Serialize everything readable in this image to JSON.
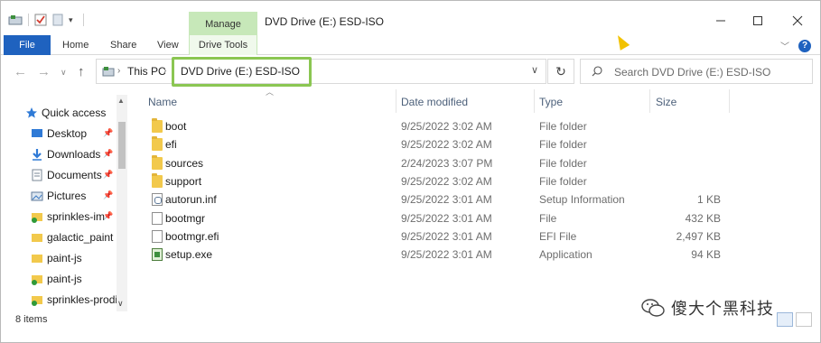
{
  "window": {
    "title": "DVD Drive (E:) ESD-ISO",
    "contextual_tab": "Manage"
  },
  "ribbon": {
    "tabs": [
      {
        "label": "File"
      },
      {
        "label": "Home"
      },
      {
        "label": "Share"
      },
      {
        "label": "View"
      },
      {
        "label": "Drive Tools"
      }
    ]
  },
  "address": {
    "breadcrumb": [
      "This PC",
      "DVD Drive (E:) ESD-ISO"
    ],
    "highlight_color": "#8bc652"
  },
  "search": {
    "placeholder": "Search DVD Drive (E:) ESD-ISO"
  },
  "nav": {
    "items": [
      {
        "label": "Quick access",
        "icon": "star-icon",
        "pinned": false
      },
      {
        "label": "Desktop",
        "icon": "desktop-icon",
        "pinned": true
      },
      {
        "label": "Downloads",
        "icon": "download-icon",
        "pinned": true
      },
      {
        "label": "Documents",
        "icon": "documents-icon",
        "pinned": true
      },
      {
        "label": "Pictures",
        "icon": "pictures-icon",
        "pinned": true
      },
      {
        "label": "sprinkles-im",
        "icon": "synced-folder-icon",
        "pinned": true
      },
      {
        "label": "galactic_paint",
        "icon": "folder-icon",
        "pinned": false
      },
      {
        "label": "paint-js",
        "icon": "folder-icon",
        "pinned": false
      },
      {
        "label": "paint-js",
        "icon": "synced-folder-icon",
        "pinned": false
      },
      {
        "label": "sprinkles-prodi",
        "icon": "synced-folder-icon",
        "pinned": false
      }
    ]
  },
  "columns": {
    "name": "Name",
    "date": "Date modified",
    "type": "Type",
    "size": "Size"
  },
  "files": [
    {
      "name": "boot",
      "date": "9/25/2022 3:02 AM",
      "type": "File folder",
      "size": "",
      "icon": "folder-icon"
    },
    {
      "name": "efi",
      "date": "9/25/2022 3:02 AM",
      "type": "File folder",
      "size": "",
      "icon": "folder-icon"
    },
    {
      "name": "sources",
      "date": "2/24/2023 3:07 PM",
      "type": "File folder",
      "size": "",
      "icon": "folder-icon"
    },
    {
      "name": "support",
      "date": "9/25/2022 3:02 AM",
      "type": "File folder",
      "size": "",
      "icon": "folder-icon"
    },
    {
      "name": "autorun.inf",
      "date": "9/25/2022 3:01 AM",
      "type": "Setup Information",
      "size": "1 KB",
      "icon": "inf-file-icon"
    },
    {
      "name": "bootmgr",
      "date": "9/25/2022 3:01 AM",
      "type": "File",
      "size": "432 KB",
      "icon": "file-icon"
    },
    {
      "name": "bootmgr.efi",
      "date": "9/25/2022 3:01 AM",
      "type": "EFI File",
      "size": "2,497 KB",
      "icon": "file-icon"
    },
    {
      "name": "setup.exe",
      "date": "9/25/2022 3:01 AM",
      "type": "Application",
      "size": "94 KB",
      "icon": "exe-icon"
    }
  ],
  "status": {
    "item_count": "8 items"
  },
  "watermark": {
    "text": "傻大个黑科技"
  },
  "colors": {
    "file_tab": "#1f62bf",
    "manage_tab": "#c7e8b9",
    "header_text": "#4c607a"
  }
}
